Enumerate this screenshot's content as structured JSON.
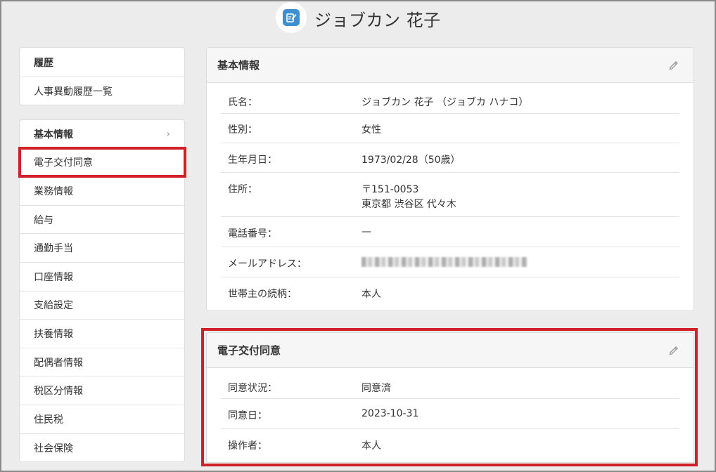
{
  "header": {
    "employee_name": "ジョブカン 花子",
    "avatar_icon": "edit-note-icon"
  },
  "sidebar_history": {
    "title": "履歴",
    "items": [
      "人事異動履歴一覧"
    ]
  },
  "sidebar_main": {
    "items": [
      "基本情報",
      "電子交付同意",
      "業務情報",
      "給与",
      "通勤手当",
      "口座情報",
      "支給設定",
      "扶養情報",
      "配偶者情報",
      "税区分情報",
      "住民税",
      "社会保険"
    ],
    "active_chevron": "›"
  },
  "basic_info": {
    "title": "基本情報",
    "edit_icon": "pencil-icon",
    "rows": [
      {
        "label": "氏名：",
        "value": "ジョブカン 花子 （ジョブカ ハナコ）"
      },
      {
        "label": "性別：",
        "value": "女性"
      },
      {
        "label": "生年月日：",
        "value": "1973/02/28（50歳）"
      },
      {
        "label": "住所：",
        "value": "〒151-0053",
        "value2": "東京都 渋谷区 代々木"
      },
      {
        "label": "電話番号：",
        "value": "—"
      },
      {
        "label": "メールアドレス：",
        "value": ""
      },
      {
        "label": "世帯主の続柄：",
        "value": "本人"
      }
    ]
  },
  "consent": {
    "title": "電子交付同意",
    "edit_icon": "pencil-icon",
    "rows": [
      {
        "label": "同意状況：",
        "value": "同意済"
      },
      {
        "label": "同意日：",
        "value": "2023-10-31"
      },
      {
        "label": "操作者：",
        "value": "本人"
      }
    ]
  },
  "colors": {
    "highlight": "#d0202a",
    "accent": "#3d8fcf"
  }
}
